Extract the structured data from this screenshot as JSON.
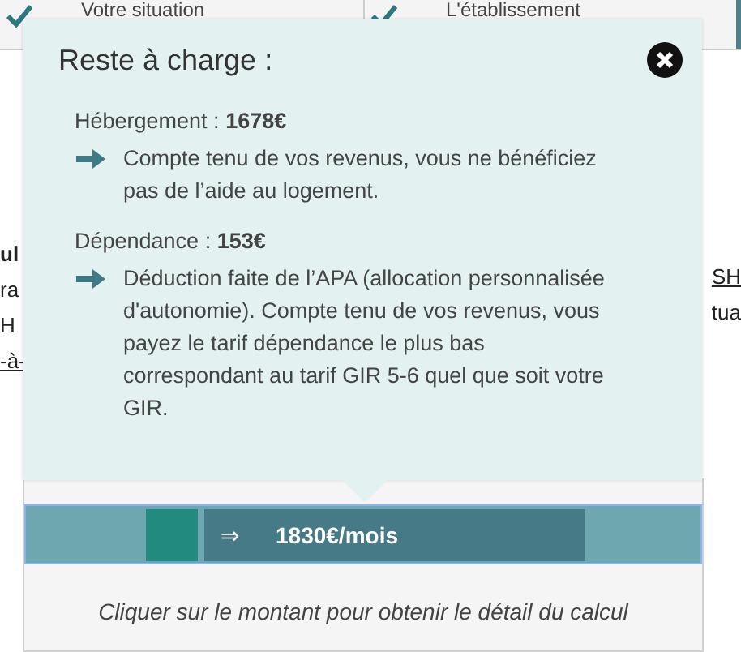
{
  "tabs": [
    {
      "label": "Votre situation",
      "checked": true
    },
    {
      "label": "L'établissement",
      "checked": true
    }
  ],
  "left_fragments": [
    {
      "text": "ul",
      "kind": "bold"
    },
    {
      "text": "ra",
      "kind": "plain"
    },
    {
      "text": "H",
      "kind": "plain"
    },
    {
      "text": "-à-",
      "kind": "link"
    }
  ],
  "right_fragments": [
    {
      "text": "SH",
      "kind": "link"
    },
    {
      "text": "tua",
      "kind": "plain"
    }
  ],
  "popup": {
    "title": "Reste à charge :",
    "sections": [
      {
        "label": "Hébergement : **1678€**",
        "detail": "Compte tenu de vos revenus, vous ne bénéficiez pas de l’aide au logement."
      },
      {
        "label": "Dépendance : **153€**",
        "detail": "Déduction faite de l’APA (allocation personnalisée d'autonomie). Compte tenu de vos revenus, vous payez le tarif dépendance le plus bas correspondant au tarif GIR 5-6 quel que soit votre GIR."
      }
    ]
  },
  "total": {
    "arrow": "⇒",
    "amount": "1830€/mois"
  },
  "hint": "Cliquer sur le montant pour obtenir le détail du calcul"
}
